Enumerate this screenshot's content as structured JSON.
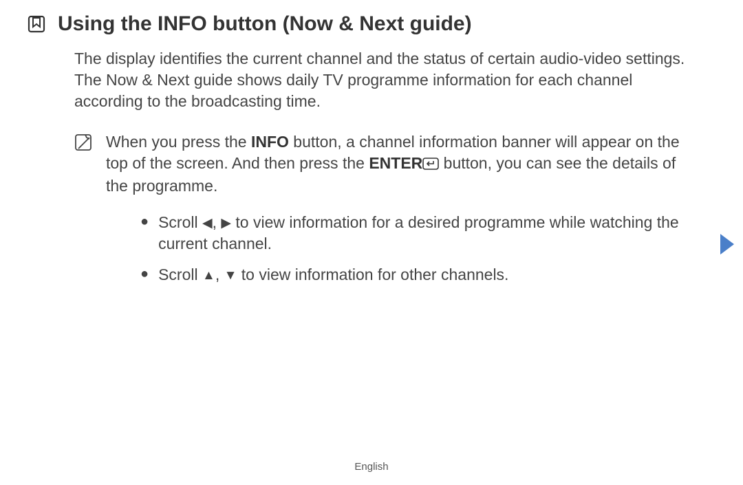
{
  "heading": {
    "title": "Using the INFO button (Now & Next guide)"
  },
  "body": {
    "p1": "The display identifies the current channel and the status of certain audio-video settings.",
    "p2": "The Now & Next guide shows daily TV programme information for each channel according to the broadcasting time."
  },
  "note": {
    "pre1": "When you press the ",
    "b1": "INFO",
    "mid1": " button, a channel information banner will appear on the top of the screen. And then press the ",
    "b2": "ENTER",
    "post1": " button, you can see the details of the programme."
  },
  "bullets": {
    "item1": {
      "pre": "Scroll ",
      "left": "◀",
      "sep": ", ",
      "right": "▶",
      "post": " to view information for a desired programme while watching the current channel."
    },
    "item2": {
      "pre": "Scroll ",
      "up": "▲",
      "sep": ", ",
      "down": "▼",
      "post": " to view information for other channels."
    }
  },
  "footer": {
    "language": "English"
  }
}
